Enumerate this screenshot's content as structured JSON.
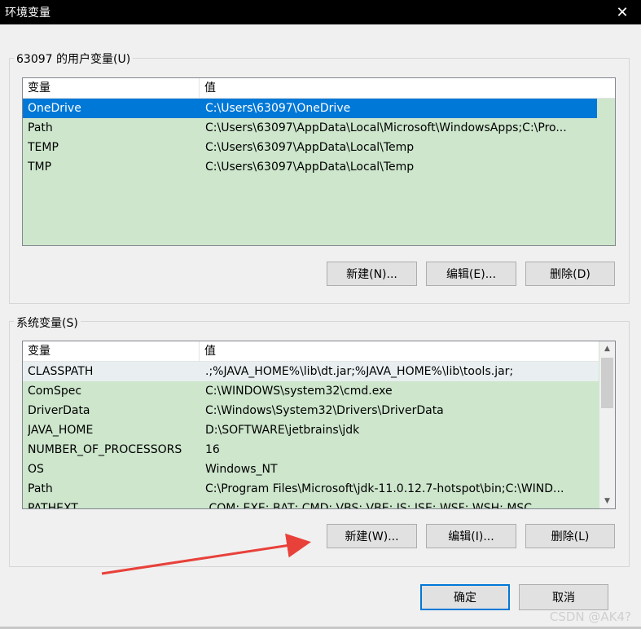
{
  "window": {
    "title": "环境变量",
    "close_glyph": "✕"
  },
  "user_vars": {
    "group_label": "63097 的用户变量(U)",
    "columns": [
      "变量",
      "值"
    ],
    "rows": [
      {
        "name": "OneDrive",
        "value": "C:\\Users\\63097\\OneDrive",
        "selected": true
      },
      {
        "name": "Path",
        "value": "C:\\Users\\63097\\AppData\\Local\\Microsoft\\WindowsApps;C:\\Pro..."
      },
      {
        "name": "TEMP",
        "value": "C:\\Users\\63097\\AppData\\Local\\Temp"
      },
      {
        "name": "TMP",
        "value": "C:\\Users\\63097\\AppData\\Local\\Temp"
      }
    ],
    "buttons": {
      "new": "新建(N)...",
      "edit": "编辑(E)...",
      "delete": "删除(D)"
    }
  },
  "system_vars": {
    "group_label": "系统变量(S)",
    "columns": [
      "变量",
      "值"
    ],
    "rows": [
      {
        "name": "CLASSPATH",
        "value": ".;%JAVA_HOME%\\lib\\dt.jar;%JAVA_HOME%\\lib\\tools.jar;"
      },
      {
        "name": "ComSpec",
        "value": "C:\\WINDOWS\\system32\\cmd.exe"
      },
      {
        "name": "DriverData",
        "value": "C:\\Windows\\System32\\Drivers\\DriverData"
      },
      {
        "name": "JAVA_HOME",
        "value": "D:\\SOFTWARE\\jetbrains\\jdk"
      },
      {
        "name": "NUMBER_OF_PROCESSORS",
        "value": "16"
      },
      {
        "name": "OS",
        "value": "Windows_NT"
      },
      {
        "name": "Path",
        "value": "C:\\Program Files\\Microsoft\\jdk-11.0.12.7-hotspot\\bin;C:\\WIND..."
      },
      {
        "name": "PATHEXT",
        "value": ".COM;.EXE;.BAT;.CMD;.VBS;.VBE;.JS;.JSE;.WSF;.WSH;.MSC"
      }
    ],
    "buttons": {
      "new": "新建(W)...",
      "edit": "编辑(I)...",
      "delete": "删除(L)"
    }
  },
  "dialog_buttons": {
    "ok": "确定",
    "cancel": "取消"
  },
  "watermark": "CSDN @AK4?",
  "annotation": {
    "arrow_color": "#e8413a"
  }
}
